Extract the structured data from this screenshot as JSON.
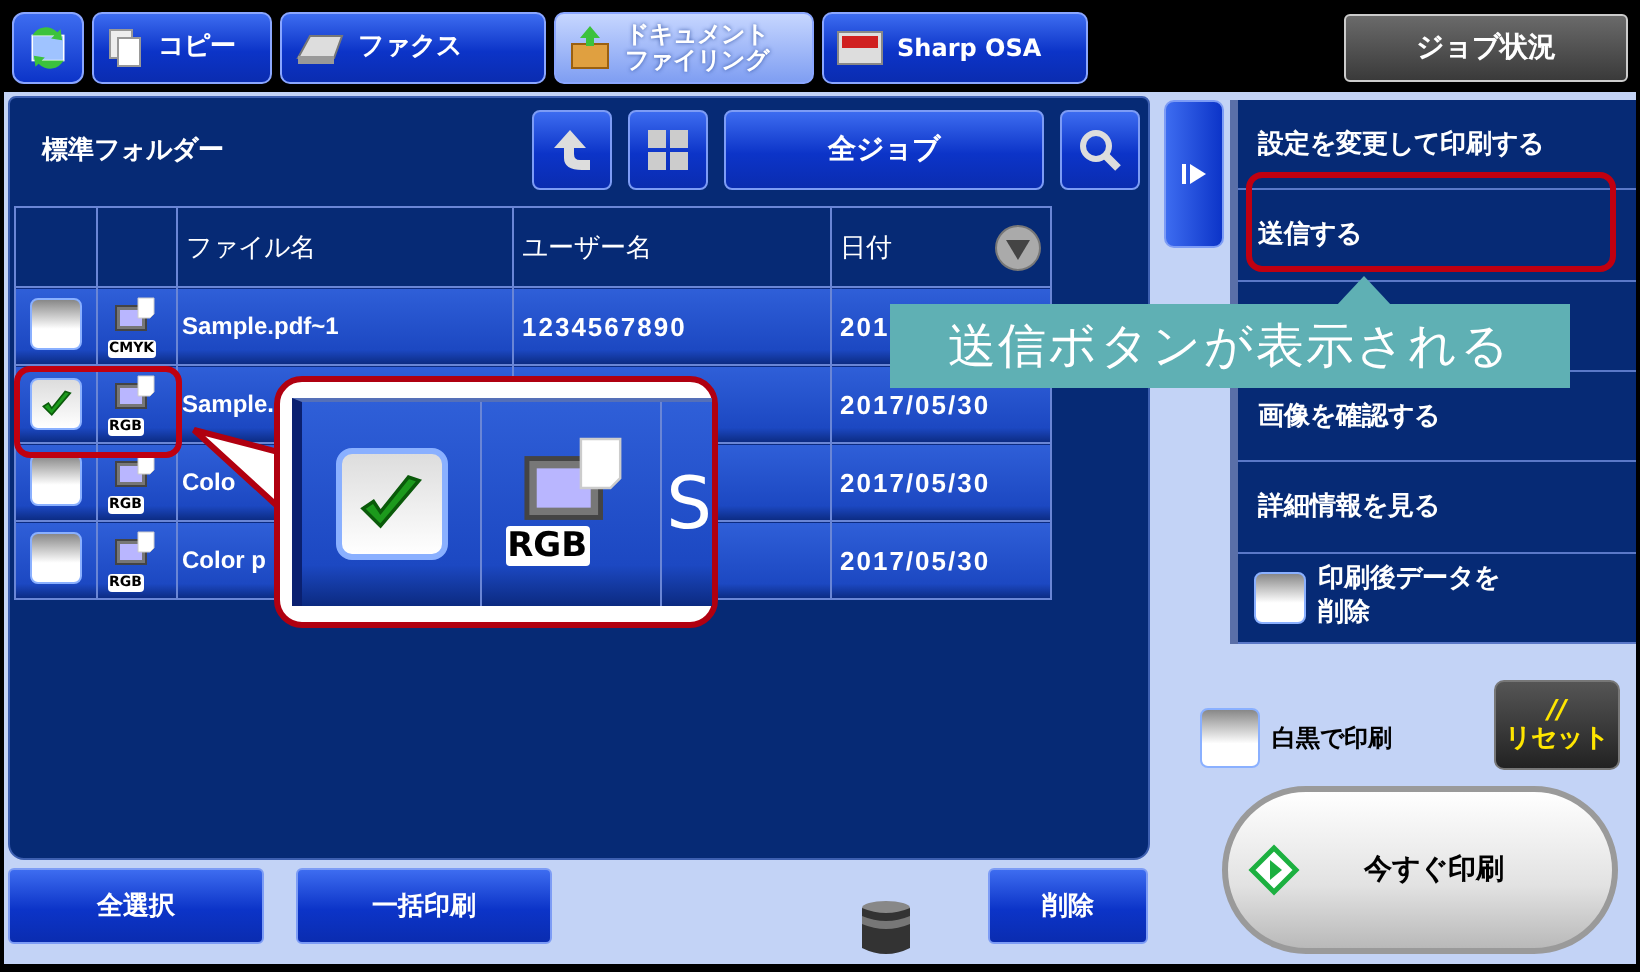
{
  "top_tabs": [
    {
      "label": "コピー",
      "selected": false
    },
    {
      "label": "ファクス",
      "selected": false
    },
    {
      "label": "ドキュメントファイリング",
      "selected": true
    },
    {
      "label": "Sharp OSA",
      "selected": false
    }
  ],
  "job_status_button": "ジョブ状況",
  "folder": {
    "title": "標準フォルダー",
    "filter_button": "全ジョブ"
  },
  "table": {
    "columns": [
      "ファイル名",
      "ユーザー名",
      "日付"
    ],
    "rows": [
      {
        "checked": false,
        "highlighted": false,
        "color_mode": "CMYK",
        "file": "Sample.pdf~1",
        "user": "1234567890",
        "date": "201"
      },
      {
        "checked": true,
        "highlighted": true,
        "color_mode": "RGB",
        "file": "Sample.",
        "date": "2017/05/30"
      },
      {
        "checked": false,
        "highlighted": false,
        "color_mode": "RGB",
        "file": "Colo",
        "date": "2017/05/30"
      },
      {
        "checked": false,
        "highlighted": false,
        "color_mode": "RGB",
        "file": "Color p",
        "date": "2017/05/30"
      }
    ]
  },
  "callout": {
    "checked": true,
    "color_mode": "RGB",
    "file": "S"
  },
  "annotation": "送信ボタンが表示される",
  "side_menu": [
    {
      "kind": "action",
      "label": "設定を変更して印刷する",
      "highlighted": false
    },
    {
      "kind": "action",
      "label": "送信する",
      "highlighted": true
    },
    {
      "kind": "covered"
    },
    {
      "kind": "action",
      "label": "画像を確認する",
      "highlighted": false
    },
    {
      "kind": "action",
      "label": "詳細情報を見る",
      "highlighted": false
    },
    {
      "kind": "checkbox",
      "label": "印刷後データを削除",
      "checked": false
    }
  ],
  "bw_print": {
    "label": "白黒で印刷",
    "checked": false
  },
  "reset": {
    "mark": "//",
    "label": "リセット"
  },
  "print_now": "今すぐ印刷",
  "bottom_buttons": [
    "全選択",
    "一括印刷"
  ],
  "delete_button": "削除"
}
